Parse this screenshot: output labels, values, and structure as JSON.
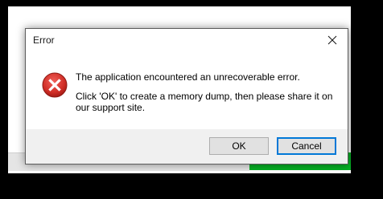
{
  "dialog": {
    "title": "Error",
    "close_icon": "close-icon",
    "status_icon": "error-icon",
    "message_line1": "The application encountered an unrecoverable error.",
    "message_line2": "Click 'OK' to create a memory dump, then please share it on our support site.",
    "ok_label": "OK",
    "cancel_label": "Cancel"
  },
  "colors": {
    "error_red": "#d02e26",
    "focus_blue": "#0078d7",
    "progress_green": "#06b025",
    "footer_gray": "#f0f0f0"
  }
}
